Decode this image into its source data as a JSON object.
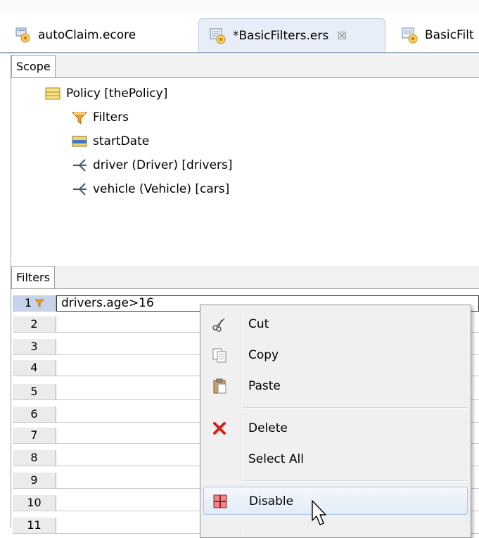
{
  "tabs": [
    {
      "label": "autoClaim.ecore",
      "icon": "ecore-model-icon",
      "active": false
    },
    {
      "label": "*BasicFilters.ers",
      "icon": "ers-file-icon",
      "active": true,
      "close": "☒"
    },
    {
      "label": "BasicFilt",
      "icon": "ers-file-icon",
      "active": false
    }
  ],
  "scope": {
    "tab_label": "Scope",
    "items": [
      {
        "label": "Policy [thePolicy]",
        "icon": "class-icon"
      },
      {
        "label": "Filters",
        "icon": "filter-funnel-icon"
      },
      {
        "label": "startDate",
        "icon": "attribute-icon"
      },
      {
        "label": "driver (Driver) [drivers]",
        "icon": "reference-icon"
      },
      {
        "label": "vehicle (Vehicle) [cars]",
        "icon": "reference-icon"
      }
    ]
  },
  "filters": {
    "tab_label": "Filters",
    "rows": [
      {
        "num": "1",
        "value": "drivers.age>16"
      },
      {
        "num": "2",
        "value": ""
      },
      {
        "num": "3",
        "value": ""
      },
      {
        "num": "4",
        "value": ""
      },
      {
        "num": "5",
        "value": ""
      },
      {
        "num": "6",
        "value": ""
      },
      {
        "num": "7",
        "value": ""
      },
      {
        "num": "8",
        "value": ""
      },
      {
        "num": "9",
        "value": ""
      },
      {
        "num": "10",
        "value": ""
      },
      {
        "num": "11",
        "value": ""
      }
    ]
  },
  "context_menu": {
    "items": [
      {
        "label": "Cut",
        "icon": "cut-scissors-icon"
      },
      {
        "label": "Copy",
        "icon": "copy-icon"
      },
      {
        "label": "Paste",
        "icon": "paste-clipboard-icon"
      },
      {
        "label": "Delete",
        "icon": "delete-x-icon"
      },
      {
        "label": "Select All",
        "icon": ""
      },
      {
        "label": "Disable",
        "icon": "disable-grid-icon"
      }
    ]
  },
  "colors": {
    "tab_active_bg": "#e8eef7",
    "row_selected_bg": "#c7d3ea",
    "menu_hover_border": "#a9c4e6",
    "delete_red": "#d42020",
    "filter_orange": "#f0a020"
  }
}
